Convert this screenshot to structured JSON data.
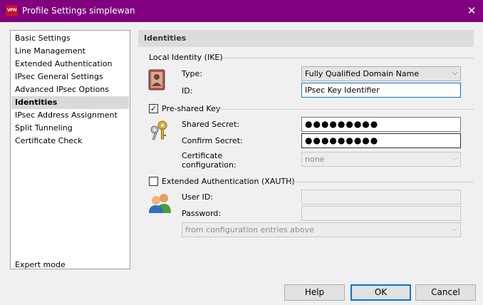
{
  "titlebar": {
    "app_icon_text": "VPN",
    "title": "Profile Settings   simplewan",
    "close_glyph": "✕"
  },
  "sidebar": {
    "items": [
      {
        "label": "Basic Settings"
      },
      {
        "label": "Line Management"
      },
      {
        "label": "Extended Authentication"
      },
      {
        "label": "IPsec General Settings"
      },
      {
        "label": "Advanced IPsec Options"
      },
      {
        "label": "Identities"
      },
      {
        "label": "IPsec Address Assignment"
      },
      {
        "label": "Split Tunneling"
      },
      {
        "label": "Certificate Check"
      }
    ],
    "selected_index": 5,
    "expert_mode": "Expert mode"
  },
  "panel": {
    "header": "Identities",
    "local_identity": {
      "title": "Local Identity (IKE)",
      "type_label": "Type:",
      "type_value": "Fully Qualified Domain Name",
      "id_label": "ID:",
      "id_value": "IPsec Key Identifier",
      "icon": "identity-card-icon"
    },
    "preshared": {
      "checkbox_label": "Pre-shared Key",
      "checked": true,
      "shared_secret_label": "Shared Secret:",
      "shared_secret_value": "●●●●●●●●●",
      "confirm_secret_label": "Confirm Secret:",
      "confirm_secret_value": "●●●●●●●●●",
      "cert_config_label_line1": "Certificate",
      "cert_config_label_line2": "configuration:",
      "cert_config_value": "none",
      "icon": "keys-icon"
    },
    "xauth": {
      "checkbox_label": "Extended Authentication (XAUTH)",
      "checked": false,
      "user_id_label": "User ID:",
      "user_id_value": "",
      "password_label": "Password:",
      "password_value": "",
      "source_value": "from configuration entries above",
      "icon": "users-icon"
    }
  },
  "buttons": {
    "help": "Help",
    "ok": "OK",
    "cancel": "Cancel"
  },
  "colors": {
    "titlebar": "#800080",
    "selected_item": "#d9d9d9",
    "focus_border": "#0078d7"
  }
}
